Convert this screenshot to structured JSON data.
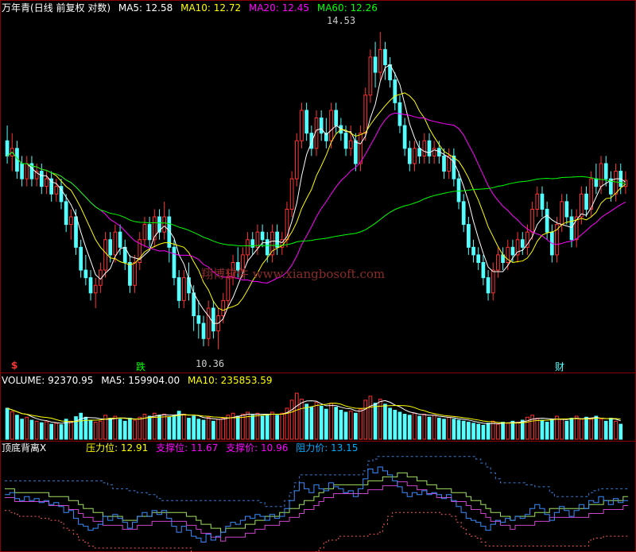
{
  "price_panel": {
    "stock_name": "万年青",
    "mode": "(日线 前复权 对数)",
    "ma5_label": "MA5: 12.58",
    "ma10_label": "MA10: 12.72",
    "ma20_label": "MA20: 12.45",
    "ma60_label": "MA60: 12.26",
    "high_label": "14.53",
    "low_label": "10.36",
    "watermark": "翔博软件 www.xiangbosoft.com",
    "markers": {
      "left": "$",
      "mid": "跌",
      "right": "财"
    },
    "colors": {
      "up": "#ff3232",
      "down": "#54ffff",
      "ma5": "#ffffff",
      "ma10": "#ffff00",
      "ma20": "#ff00ff",
      "ma60": "#00ff00"
    }
  },
  "volume_panel": {
    "volume_label": "VOLUME: 92370.95",
    "ma5_label": "MA5: 159904.00",
    "ma10_label": "MA10: 235853.59"
  },
  "indicator_panel": {
    "name": "顶底背离X",
    "pressure_label": "压力位: 12.91",
    "support_label": "支撑位: 11.67",
    "support_price_label": "支撑价: 10.96",
    "resist_label": "阻力价: 13.15",
    "colors": {
      "name": "#ffffff",
      "pressure": "#ffff00",
      "support": "#ff00ff",
      "support_price": "#ff00ff",
      "resist": "#00aaff"
    }
  },
  "chart_data": {
    "type": "candlestick",
    "candles": [
      [
        13.1,
        12.9,
        13.3,
        12.8
      ],
      [
        12.9,
        13.0,
        13.2,
        12.7
      ],
      [
        13.0,
        12.7,
        13.1,
        12.6
      ],
      [
        12.8,
        12.6,
        12.9,
        12.5
      ],
      [
        12.6,
        12.8,
        12.9,
        12.5
      ],
      [
        12.8,
        12.6,
        12.9,
        12.5
      ],
      [
        12.6,
        12.7,
        12.8,
        12.5
      ],
      [
        12.7,
        12.5,
        12.8,
        12.4
      ],
      [
        12.5,
        12.6,
        12.7,
        12.4
      ],
      [
        12.6,
        12.4,
        12.7,
        12.3
      ],
      [
        12.4,
        12.5,
        12.6,
        12.3
      ],
      [
        12.5,
        12.3,
        12.6,
        12.2
      ],
      [
        12.3,
        12.0,
        12.4,
        11.9
      ],
      [
        12.0,
        12.1,
        12.2,
        11.8
      ],
      [
        12.1,
        11.7,
        12.2,
        11.6
      ],
      [
        11.7,
        11.4,
        11.8,
        11.3
      ],
      [
        11.4,
        11.3,
        11.6,
        11.2
      ],
      [
        11.3,
        11.1,
        11.4,
        11.0
      ],
      [
        11.1,
        11.2,
        11.3,
        10.9
      ],
      [
        11.2,
        11.4,
        11.5,
        11.1
      ],
      [
        11.4,
        11.8,
        11.9,
        11.3
      ],
      [
        11.8,
        11.6,
        11.9,
        11.5
      ],
      [
        11.6,
        11.9,
        12.0,
        11.5
      ],
      [
        11.9,
        11.7,
        12.0,
        11.6
      ],
      [
        11.7,
        11.5,
        11.8,
        11.4
      ],
      [
        11.5,
        11.2,
        11.6,
        11.1
      ],
      [
        11.2,
        11.5,
        11.6,
        11.1
      ],
      [
        11.5,
        11.8,
        11.9,
        11.4
      ],
      [
        11.8,
        12.0,
        12.1,
        11.7
      ],
      [
        12.0,
        11.8,
        12.1,
        11.7
      ],
      [
        11.8,
        12.1,
        12.2,
        11.7
      ],
      [
        12.1,
        11.9,
        12.2,
        11.8
      ],
      [
        11.9,
        12.1,
        12.3,
        11.8
      ],
      [
        12.1,
        11.7,
        12.2,
        11.5
      ],
      [
        11.7,
        11.3,
        11.8,
        11.2
      ],
      [
        11.3,
        11.0,
        11.4,
        10.9
      ],
      [
        11.0,
        11.3,
        11.4,
        10.9
      ],
      [
        11.3,
        11.1,
        11.5,
        11.0
      ],
      [
        11.1,
        10.8,
        11.2,
        10.6
      ],
      [
        10.8,
        10.7,
        11.0,
        10.5
      ],
      [
        10.7,
        10.5,
        10.8,
        10.4
      ],
      [
        10.5,
        10.9,
        11.0,
        10.4
      ],
      [
        10.9,
        10.6,
        11.0,
        10.5
      ],
      [
        10.6,
        10.8,
        10.9,
        10.36
      ],
      [
        10.8,
        11.0,
        11.1,
        10.7
      ],
      [
        11.0,
        11.3,
        11.4,
        10.9
      ],
      [
        11.3,
        11.5,
        11.6,
        11.2
      ],
      [
        11.5,
        11.4,
        11.7,
        11.3
      ],
      [
        11.4,
        11.6,
        11.7,
        11.3
      ],
      [
        11.6,
        11.8,
        11.9,
        11.5
      ],
      [
        11.8,
        11.7,
        11.9,
        11.6
      ],
      [
        11.7,
        11.9,
        12.0,
        11.6
      ],
      [
        11.9,
        11.8,
        12.0,
        11.7
      ],
      [
        11.8,
        11.6,
        11.9,
        11.5
      ],
      [
        11.6,
        11.9,
        12.0,
        11.5
      ],
      [
        11.9,
        11.7,
        12.0,
        11.6
      ],
      [
        11.7,
        11.8,
        11.9,
        11.6
      ],
      [
        11.8,
        12.2,
        12.3,
        11.7
      ],
      [
        12.2,
        12.6,
        12.7,
        12.1
      ],
      [
        12.6,
        13.1,
        13.2,
        12.5
      ],
      [
        13.1,
        13.5,
        13.6,
        13.0
      ],
      [
        13.5,
        13.2,
        13.6,
        13.1
      ],
      [
        13.2,
        13.0,
        13.3,
        12.9
      ],
      [
        13.0,
        13.4,
        13.5,
        12.9
      ],
      [
        13.4,
        13.2,
        13.5,
        13.1
      ],
      [
        13.2,
        13.1,
        13.4,
        13.0
      ],
      [
        13.1,
        13.5,
        13.6,
        13.0
      ],
      [
        13.5,
        13.3,
        13.6,
        13.2
      ],
      [
        13.3,
        13.2,
        13.4,
        13.1
      ],
      [
        13.2,
        13.0,
        13.3,
        12.9
      ],
      [
        13.0,
        13.1,
        13.3,
        12.9
      ],
      [
        13.1,
        12.8,
        13.2,
        12.7
      ],
      [
        12.8,
        13.2,
        13.3,
        12.7
      ],
      [
        13.2,
        13.7,
        13.8,
        13.1
      ],
      [
        13.7,
        14.2,
        14.3,
        13.6
      ],
      [
        14.2,
        14.0,
        14.4,
        13.8
      ],
      [
        14.0,
        14.3,
        14.53,
        13.9
      ],
      [
        14.3,
        14.1,
        14.4,
        13.9
      ],
      [
        14.1,
        13.9,
        14.2,
        13.8
      ],
      [
        13.9,
        13.6,
        14.0,
        13.5
      ],
      [
        13.6,
        13.3,
        13.7,
        13.2
      ],
      [
        13.3,
        13.0,
        13.4,
        12.9
      ],
      [
        13.0,
        12.8,
        13.1,
        12.7
      ],
      [
        12.8,
        13.0,
        13.1,
        12.7
      ],
      [
        13.0,
        12.9,
        13.1,
        12.8
      ],
      [
        12.9,
        13.1,
        13.2,
        12.8
      ],
      [
        13.1,
        12.9,
        13.2,
        12.8
      ],
      [
        12.9,
        13.0,
        13.1,
        12.8
      ],
      [
        13.0,
        12.9,
        13.1,
        12.8
      ],
      [
        12.9,
        12.7,
        13.0,
        12.6
      ],
      [
        12.7,
        12.9,
        13.0,
        12.6
      ],
      [
        12.9,
        12.6,
        13.0,
        12.5
      ],
      [
        12.6,
        12.3,
        12.7,
        12.2
      ],
      [
        12.3,
        12.0,
        12.4,
        11.9
      ],
      [
        12.0,
        11.7,
        12.1,
        11.6
      ],
      [
        11.7,
        11.6,
        11.8,
        11.5
      ],
      [
        11.6,
        11.5,
        11.7,
        11.4
      ],
      [
        11.5,
        11.3,
        11.6,
        11.2
      ],
      [
        11.3,
        11.1,
        11.4,
        11.0
      ],
      [
        11.1,
        11.4,
        11.5,
        11.0
      ],
      [
        11.4,
        11.6,
        11.7,
        11.3
      ],
      [
        11.6,
        11.5,
        11.7,
        11.4
      ],
      [
        11.5,
        11.7,
        11.8,
        11.4
      ],
      [
        11.7,
        11.6,
        11.8,
        11.5
      ],
      [
        11.6,
        11.8,
        11.9,
        11.5
      ],
      [
        11.8,
        11.7,
        11.9,
        11.6
      ],
      [
        11.7,
        11.9,
        12.0,
        11.6
      ],
      [
        11.9,
        12.2,
        12.3,
        11.8
      ],
      [
        12.2,
        12.4,
        12.5,
        12.1
      ],
      [
        12.4,
        12.2,
        12.5,
        12.1
      ],
      [
        12.2,
        11.9,
        12.3,
        11.8
      ],
      [
        11.9,
        11.6,
        12.0,
        11.5
      ],
      [
        11.6,
        12.0,
        12.1,
        11.5
      ],
      [
        12.0,
        12.3,
        12.4,
        11.9
      ],
      [
        12.3,
        12.1,
        12.4,
        12.0
      ],
      [
        12.1,
        11.8,
        12.2,
        11.7
      ],
      [
        11.8,
        12.1,
        12.2,
        11.7
      ],
      [
        12.1,
        12.4,
        12.5,
        12.0
      ],
      [
        12.4,
        12.2,
        12.5,
        12.1
      ],
      [
        12.2,
        12.6,
        12.7,
        12.1
      ],
      [
        12.6,
        12.5,
        12.8,
        12.4
      ],
      [
        12.5,
        12.8,
        12.9,
        12.4
      ],
      [
        12.8,
        12.6,
        12.9,
        12.5
      ],
      [
        12.6,
        12.4,
        12.7,
        12.3
      ],
      [
        12.4,
        12.7,
        12.8,
        12.3
      ],
      [
        12.7,
        12.5,
        12.8,
        12.4
      ],
      [
        12.5,
        12.58,
        12.7,
        12.4
      ]
    ],
    "volumes": [
      62,
      55,
      48,
      40,
      44,
      38,
      36,
      33,
      35,
      30,
      32,
      29,
      40,
      36,
      45,
      52,
      44,
      38,
      34,
      36,
      48,
      42,
      46,
      40,
      36,
      42,
      38,
      44,
      50,
      46,
      52,
      48,
      50,
      44,
      48,
      56,
      50,
      42,
      46,
      40,
      38,
      44,
      36,
      40,
      42,
      48,
      52,
      46,
      50,
      54,
      48,
      52,
      46,
      50,
      54,
      48,
      52,
      62,
      78,
      92,
      80,
      70,
      64,
      74,
      66,
      60,
      72,
      64,
      58,
      54,
      56,
      52,
      60,
      78,
      86,
      72,
      80,
      70,
      62,
      58,
      54,
      50,
      48,
      52,
      46,
      50,
      44,
      48,
      42,
      40,
      44,
      40,
      38,
      36,
      34,
      32,
      30,
      28,
      32,
      36,
      30,
      34,
      32,
      36,
      34,
      38,
      44,
      48,
      42,
      38,
      34,
      40,
      46,
      40,
      36,
      42,
      46,
      40,
      44,
      40,
      46,
      40,
      36,
      42,
      36,
      30
    ]
  }
}
